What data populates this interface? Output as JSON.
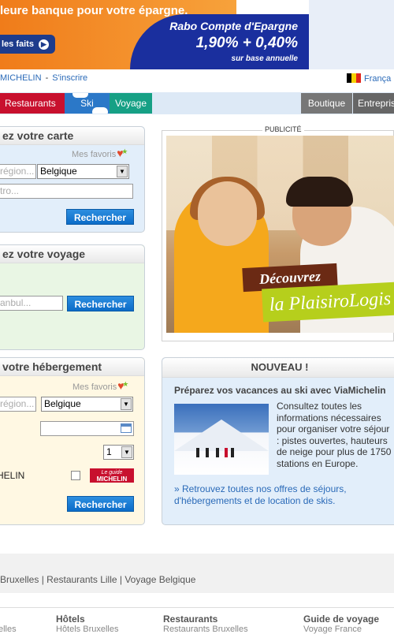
{
  "banner": {
    "slogan": "leure banque pour votre épargne.",
    "cta": "les faits",
    "product": "Rabo Compte d'Epargne",
    "rates": "1,90% + 0,40%",
    "rates_note": "sur base annuelle"
  },
  "toplinks": {
    "brand": "MICHELIN",
    "register": "S'inscrire",
    "language": "França"
  },
  "nav": {
    "restaurants": "Restaurants",
    "ski": "Ski",
    "voyage": "Voyage",
    "boutique": "Boutique",
    "entreprise": "Entrepris"
  },
  "carte": {
    "title": "ez votre carte",
    "favoris": "Mes favoris",
    "region_placeholder": "région...",
    "country": "Belgique",
    "address_placeholder": "tro...",
    "search": "Rechercher"
  },
  "voyage_panel": {
    "title": "ez votre voyage",
    "place_placeholder": "anbul...",
    "search": "Rechercher"
  },
  "heberg": {
    "title": "votre hébergement",
    "favoris": "Mes favoris",
    "region_placeholder": "région...",
    "country": "Belgique",
    "rooms": "1",
    "michelin_label": "HELIN",
    "guide_top": "Le guide",
    "guide_bottom": "MICHELIN",
    "search": "Rechercher"
  },
  "pub": {
    "label": "PUBLICITÉ",
    "decouvrez": "Découvrez",
    "brand": "la PlaisiroLogis"
  },
  "nouveau": {
    "title": "NOUVEAU !",
    "headline": "Préparez vos vacances au ski avec ViaMichelin",
    "body": "Consultez toutes les informations nécessaires pour organiser votre séjour : pistes ouvertes, hauteurs de neige pour plus de 1750 stations en Europe.",
    "link": "» Retrouvez toutes nos offres de séjours, d'hébergements et de location de skis."
  },
  "footer": {
    "seo_links": [
      "Bruxelles",
      "Restaurants Lille",
      "Voyage Belgique"
    ],
    "columns": [
      {
        "title": "Hôtels",
        "sub": "Hôtels Bruxelles"
      },
      {
        "title": "Restaurants",
        "sub": "Restaurants Bruxelles"
      },
      {
        "title": "Guide de voyage",
        "sub": "Voyage France"
      }
    ],
    "left_sub": "elles"
  },
  "colors": {
    "restaurants": "#c8102e",
    "ski": "#2b78c8",
    "voyage": "#16a085",
    "button": "#0b6cc8",
    "link": "#2a6ab8"
  }
}
